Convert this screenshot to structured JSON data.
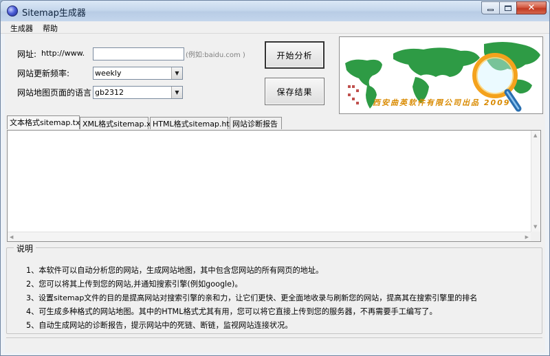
{
  "window": {
    "title": "Sitemap生成器"
  },
  "menu": {
    "items": [
      "生成器",
      "帮助"
    ]
  },
  "form": {
    "url_label": "网址:",
    "url_prefix": "http://www.",
    "url_value": "",
    "url_hint": "(例如:baidu.com )",
    "freq_label": "网站更新频率:",
    "freq_value": "weekly",
    "lang_label": "网站地图页面的语言",
    "lang_value": "gb2312"
  },
  "buttons": {
    "analyze": "开始分析",
    "save": "保存结果"
  },
  "banner": {
    "text": "西安曲英软件有限公司出品 2009"
  },
  "tabs": [
    "文本格式sitemap.txt",
    "XML格式sitemap.xml",
    "HTML格式sitemap.html",
    "网站诊断报告"
  ],
  "instructions": {
    "title": "说明",
    "lines": [
      "1、本软件可以自动分析您的网站，生成网站地图，其中包含您网站的所有网页的地址。",
      "2、您可以将其上传到您的网站,并通知搜索引擎(例如google)。",
      "3、设置sitemap文件的目的是提高网站对搜索引擎的亲和力，让它们更快、更全面地收录与刷新您的网站，提高其在搜索引擎里的排名",
      "4、可生成多种格式的网站地图。其中的HTML格式尤其有用，您可以将它直接上传到您的服务器，不再需要手工编写了。",
      "5、自动生成网站的诊断报告，提示网站中的死链、断链，监视网站连接状况。"
    ]
  },
  "colors": {
    "map_land": "#2e9b45",
    "map_sea": "#ffffff",
    "magnifier_rim": "#f4a21c",
    "banner_text": "#d98a00"
  }
}
